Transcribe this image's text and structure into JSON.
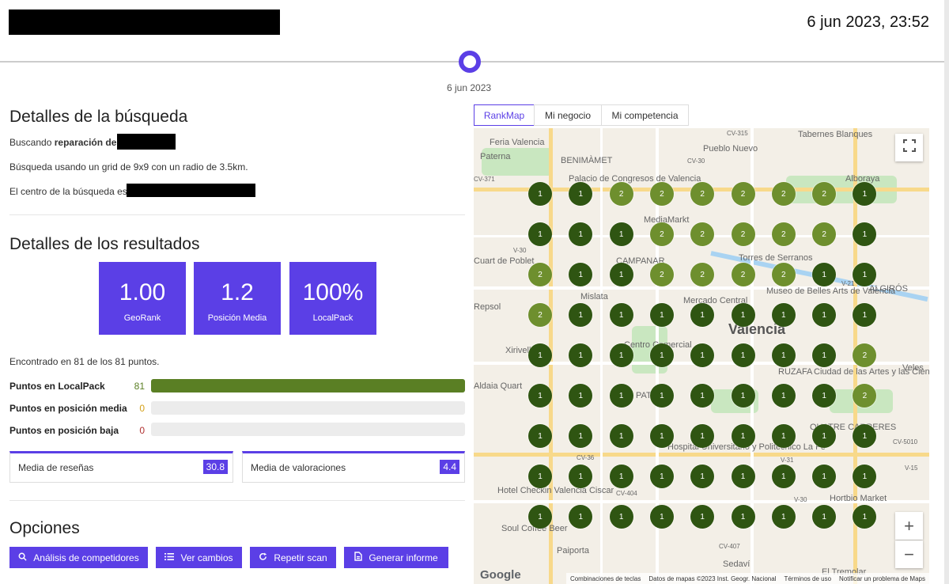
{
  "header": {
    "date": "6 jun 2023, 23:52"
  },
  "timeline": {
    "date": "6 jun 2023"
  },
  "search": {
    "title": "Detalles de la búsqueda",
    "searching_prefix": "Buscando",
    "keyword": "reparación de",
    "grid_text": "Búsqueda usando un grid de 9x9 con un radio de 3.5km.",
    "center_text": "El centro de la búsqueda es:"
  },
  "results": {
    "title": "Detalles de los resultados",
    "stats": [
      {
        "value": "1.00",
        "label": "GeoRank"
      },
      {
        "value": "1.2",
        "label": "Posición Media"
      },
      {
        "value": "100%",
        "label": "LocalPack"
      }
    ],
    "found_text": "Encontrado en 81 de los 81 puntos.",
    "bars": [
      {
        "label": "Puntos en LocalPack",
        "value": "81",
        "fraction": 1.0,
        "color": "#5a7f24"
      },
      {
        "label": "Puntos en posición media",
        "value": "0",
        "fraction": 0,
        "color": "#d4a017"
      },
      {
        "label": "Puntos en posición baja",
        "value": "0",
        "fraction": 0,
        "color": "#b03030"
      }
    ],
    "metrics": [
      {
        "label": "Media de reseñas",
        "value": "30.8"
      },
      {
        "label": "Media de valoraciones",
        "value": "4.4"
      }
    ]
  },
  "options": {
    "title": "Opciones",
    "buttons": [
      {
        "label": "Análisis de competidores",
        "icon": "search-icon"
      },
      {
        "label": "Ver cambios",
        "icon": "list-icon"
      },
      {
        "label": "Repetir scan",
        "icon": "refresh-icon"
      },
      {
        "label": "Generar informe",
        "icon": "document-icon"
      }
    ]
  },
  "map": {
    "tabs": [
      "RankMap",
      "Mi negocio",
      "Mi competencia"
    ],
    "active_tab": "RankMap",
    "grid": [
      [
        1,
        1,
        2,
        2,
        2,
        2,
        2,
        2,
        1
      ],
      [
        1,
        1,
        1,
        2,
        2,
        2,
        2,
        2,
        1
      ],
      [
        2,
        1,
        1,
        2,
        2,
        2,
        2,
        1,
        1
      ],
      [
        2,
        1,
        1,
        1,
        1,
        1,
        1,
        1,
        1
      ],
      [
        1,
        1,
        1,
        1,
        1,
        1,
        1,
        1,
        2
      ],
      [
        1,
        1,
        1,
        1,
        1,
        1,
        1,
        1,
        2
      ],
      [
        1,
        1,
        1,
        1,
        1,
        1,
        1,
        1,
        1
      ],
      [
        1,
        1,
        1,
        1,
        1,
        1,
        1,
        1,
        1
      ],
      [
        1,
        1,
        1,
        1,
        1,
        1,
        1,
        1,
        1
      ]
    ],
    "labels": [
      "Feria Valencia",
      "Paterna",
      "BENIMÀMET",
      "Pueblo Nuevo",
      "Tabernes Blanques",
      "Alboraya",
      "Palacio de Congresos de Valencia",
      "MediaMarkt",
      "Cuart de Poblet",
      "CAMPANAR",
      "Torres de Serranos",
      "Mislata",
      "Mercado Central",
      "Museo de Belles Arts de València",
      "ALGIRÓS",
      "Valencia",
      "Centro Comercial",
      "RUZAFA",
      "Ciudad de las Artes y las Ciencias",
      "Veles",
      "Xirivella",
      "Aldaia Quart",
      "PATRAIX",
      "QUATRE CARRERES",
      "Hospital Universitario y Politécnico La Fe",
      "Hortbio Market",
      "Hotel Checkin Valencia Ciscar",
      "Soul Coffee Beer",
      "Paiporta",
      "Sedaví",
      "El Tremolar",
      "Repsol"
    ],
    "road_labels": [
      "CV-315",
      "CV-30",
      "CV-371",
      "V-30",
      "V-21",
      "CV-5010",
      "V-15",
      "CV-36",
      "CV-404",
      "V-31",
      "CV-407",
      "V-30"
    ],
    "footer": [
      "Combinaciones de teclas",
      "Datos de mapas ©2023 Inst. Geogr. Nacional",
      "Términos de uso",
      "Notificar un problema de Maps"
    ],
    "google": "Google",
    "zoom_in": "+",
    "zoom_out": "−",
    "colors": {
      "rank1": "#2f5512",
      "rank2": "#6e8f2e"
    }
  }
}
